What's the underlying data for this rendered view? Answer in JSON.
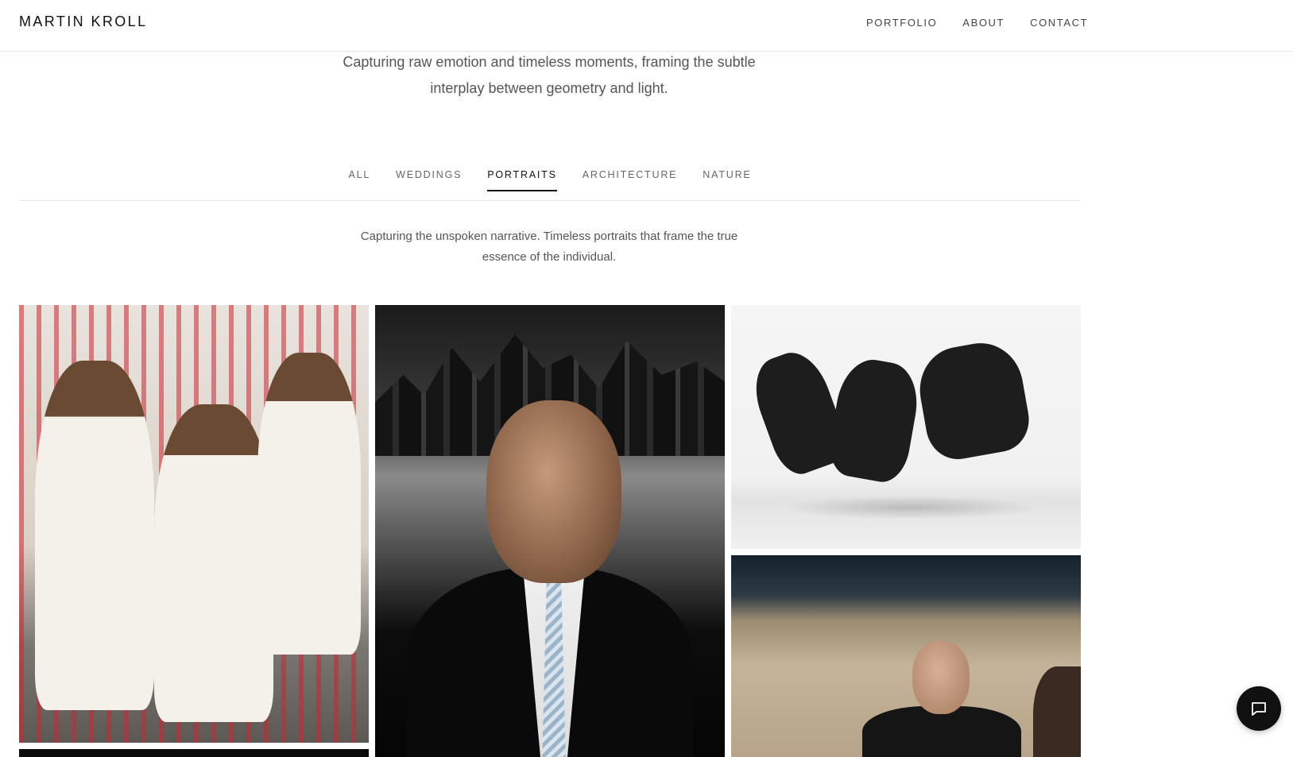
{
  "header": {
    "brand": "MARTIN KROLL",
    "nav": [
      "PORTFOLIO",
      "ABOUT",
      "CONTACT"
    ]
  },
  "intro": {
    "text": "Capturing raw emotion and timeless moments, framing the subtle interplay between geometry and light."
  },
  "filters": {
    "tabs": [
      "ALL",
      "WEDDINGS",
      "PORTRAITS",
      "ARCHITECTURE",
      "NATURE"
    ],
    "active": "PORTRAITS"
  },
  "category": {
    "description": "Capturing the unspoken narrative. Timeless portraits that frame the true essence of the individual."
  },
  "chat": {
    "icon": "chat-bubble-icon"
  }
}
